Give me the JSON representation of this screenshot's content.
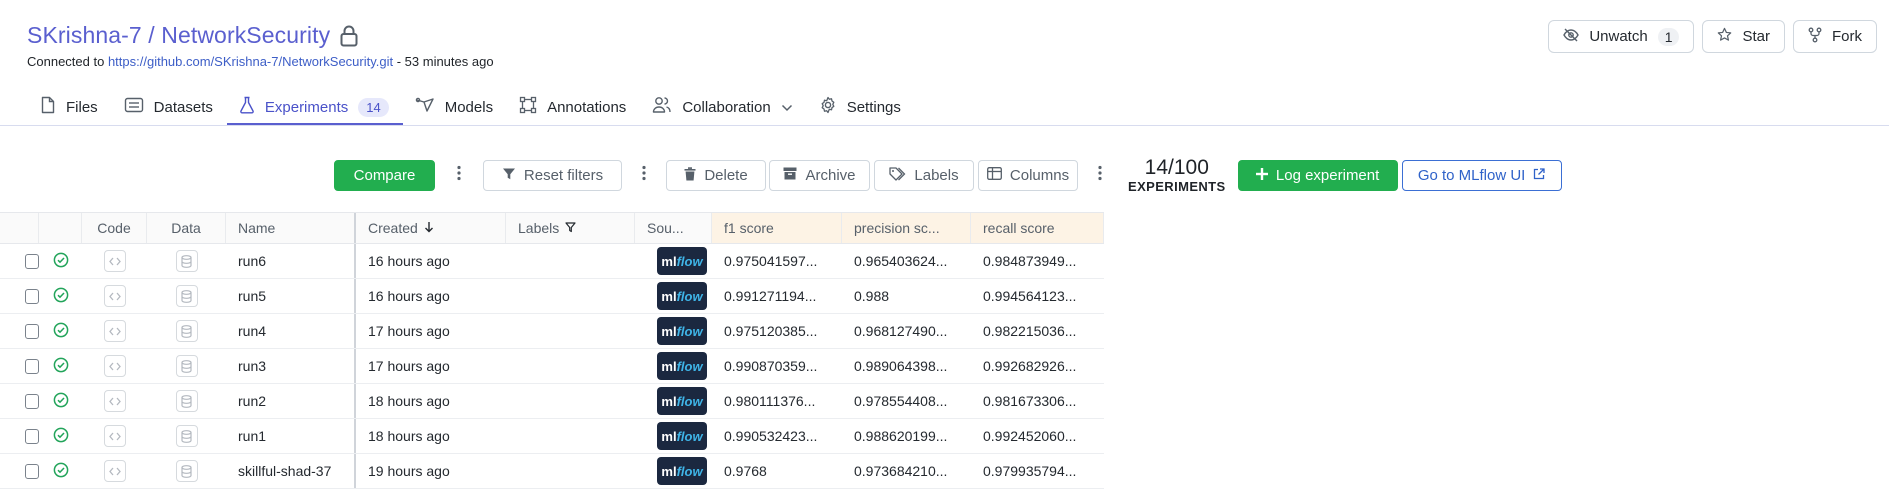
{
  "repo": {
    "title": "SKrishna-7 / NetworkSecurity",
    "connected_prefix": "Connected to ",
    "connected_url": "https://github.com/SKrishna-7/NetworkSecurity.git",
    "connected_suffix": " - 53 minutes ago"
  },
  "header_buttons": {
    "unwatch_label": "Unwatch",
    "unwatch_count": "1",
    "star_label": "Star",
    "fork_label": "Fork"
  },
  "tabs": [
    {
      "label": "Files"
    },
    {
      "label": "Datasets"
    },
    {
      "label": "Experiments",
      "badge": "14"
    },
    {
      "label": "Models"
    },
    {
      "label": "Annotations"
    },
    {
      "label": "Collaboration"
    },
    {
      "label": "Settings"
    }
  ],
  "toolbar": {
    "compare": "Compare",
    "reset_filters": "Reset filters",
    "delete": "Delete",
    "archive": "Archive",
    "labels": "Labels",
    "columns": "Columns",
    "count": "14/100",
    "count_label": "EXPERIMENTS",
    "log_experiment": "Log experiment",
    "mlflow_ui": "Go to MLflow UI"
  },
  "table": {
    "headers": {
      "code": "Code",
      "data": "Data",
      "name": "Name",
      "created": "Created",
      "labels": "Labels",
      "source": "Sou...",
      "f1": "f1 score",
      "precision": "precision sc...",
      "recall": "recall score"
    },
    "rows": [
      {
        "name": "run6",
        "created": "16 hours ago",
        "f1": "0.975041597...",
        "precision": "0.965403624...",
        "recall": "0.984873949..."
      },
      {
        "name": "run5",
        "created": "16 hours ago",
        "f1": "0.991271194...",
        "precision": "0.988",
        "recall": "0.994564123..."
      },
      {
        "name": "run4",
        "created": "17 hours ago",
        "f1": "0.975120385...",
        "precision": "0.968127490...",
        "recall": "0.982215036..."
      },
      {
        "name": "run3",
        "created": "17 hours ago",
        "f1": "0.990870359...",
        "precision": "0.989064398...",
        "recall": "0.992682926..."
      },
      {
        "name": "run2",
        "created": "18 hours ago",
        "f1": "0.980111376...",
        "precision": "0.978554408...",
        "recall": "0.981673306..."
      },
      {
        "name": "run1",
        "created": "18 hours ago",
        "f1": "0.990532423...",
        "precision": "0.988620199...",
        "recall": "0.992452060..."
      },
      {
        "name": "skillful-shad-37",
        "created": "19 hours ago",
        "f1": "0.9768",
        "precision": "0.973684210...",
        "recall": "0.979935794..."
      }
    ],
    "source_badge": {
      "ml": "ml",
      "flow": "flow"
    }
  },
  "colors": {
    "accent": "#5a5fcf",
    "green": "#22ae4f",
    "link": "#3d5ec7",
    "success_icon": "#22a45a"
  }
}
